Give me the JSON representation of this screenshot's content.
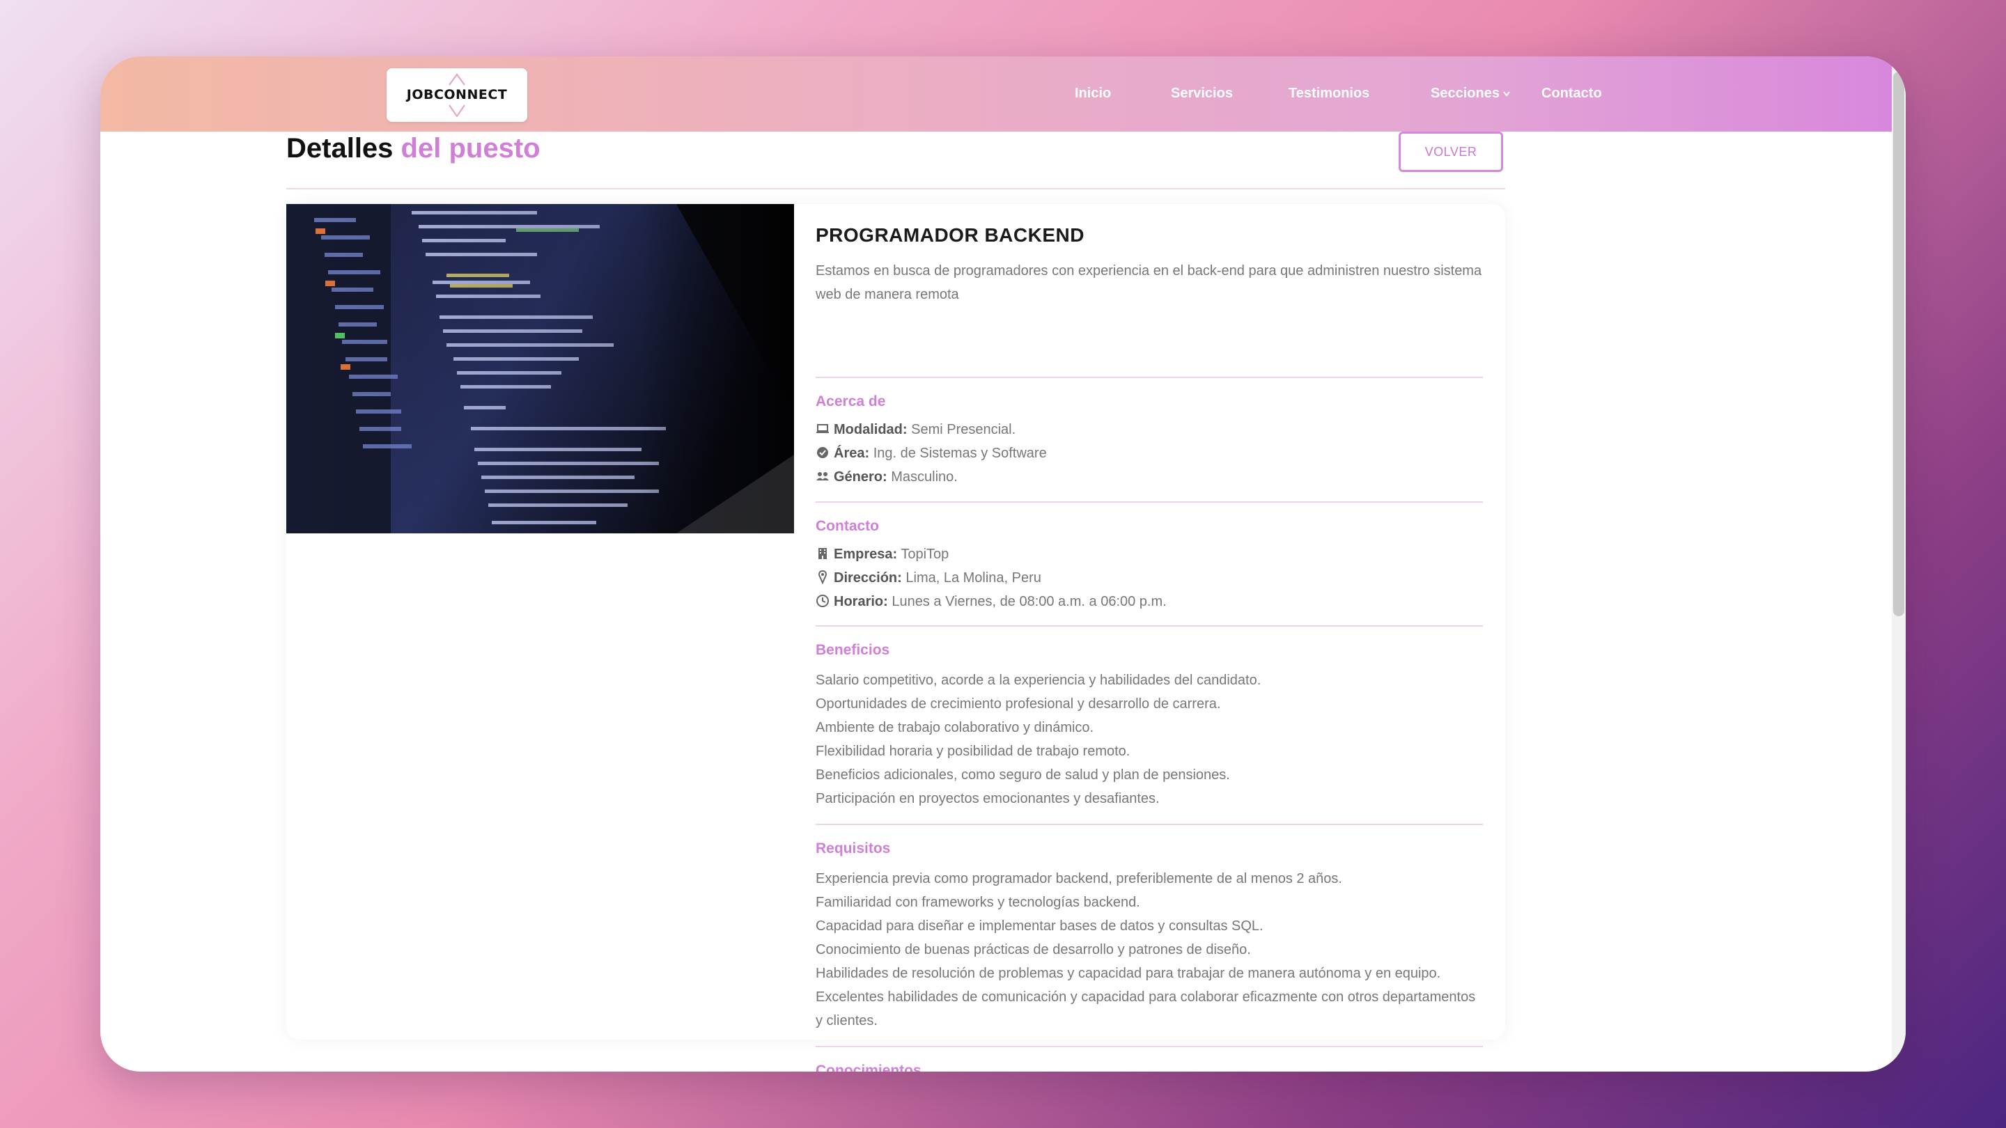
{
  "brand": {
    "logo_text": "JOBCONNECT"
  },
  "nav": {
    "items": [
      "Inicio",
      "Servicios",
      "Testimonios",
      "Secciones",
      "Contacto"
    ]
  },
  "page": {
    "title_main": "Detalles",
    "title_accent": "del puesto",
    "back_button": "VOLVER"
  },
  "job": {
    "title": "PROGRAMADOR BACKEND",
    "description": "Estamos en busca de programadores con experiencia en el back-end para que administren nuestro sistema web de manera remota"
  },
  "sections": {
    "about": {
      "title": "Acerca de",
      "rows": [
        {
          "icon": "laptop-icon",
          "label": "Modalidad:",
          "value": "Semi Presencial."
        },
        {
          "icon": "check-circle-icon",
          "label": "Área:",
          "value": "Ing. de Sistemas y Software"
        },
        {
          "icon": "users-icon",
          "label": "Género:",
          "value": "Masculino."
        }
      ]
    },
    "contact": {
      "title": "Contacto",
      "rows": [
        {
          "icon": "building-icon",
          "label": "Empresa:",
          "value": "TopiTop"
        },
        {
          "icon": "map-pin-icon",
          "label": "Dirección:",
          "value": "Lima, La Molina, Peru"
        },
        {
          "icon": "clock-icon",
          "label": "Horario:",
          "value": "Lunes a Viernes, de 08:00 a.m. a 06:00 p.m."
        }
      ]
    },
    "benefits": {
      "title": "Beneficios",
      "items": [
        "Salario competitivo, acorde a la experiencia y habilidades del candidato.",
        "Oportunidades de crecimiento profesional y desarrollo de carrera.",
        "Ambiente de trabajo colaborativo y dinámico.",
        "Flexibilidad horaria y posibilidad de trabajo remoto.",
        "Beneficios adicionales, como seguro de salud y plan de pensiones.",
        "Participación en proyectos emocionantes y desafiantes."
      ]
    },
    "requirements": {
      "title": "Requisitos",
      "items": [
        "Experiencia previa como programador backend, preferiblemente de al menos 2 años.",
        "Familiaridad con frameworks y tecnologías backend.",
        "Capacidad para diseñar e implementar bases de datos y consultas SQL.",
        "Conocimiento de buenas prácticas de desarrollo y patrones de diseño.",
        "Habilidades de resolución de problemas y capacidad para trabajar de manera autónoma y en equipo.",
        "Excelentes habilidades de comunicación y capacidad para colaborar eficazmente con otros departamentos y clientes."
      ]
    },
    "knowledge": {
      "title": "Conocimientos"
    }
  },
  "colors": {
    "accent": "#d07fd6",
    "nav_start": "#f3b9a4",
    "nav_end": "#d888dc"
  }
}
